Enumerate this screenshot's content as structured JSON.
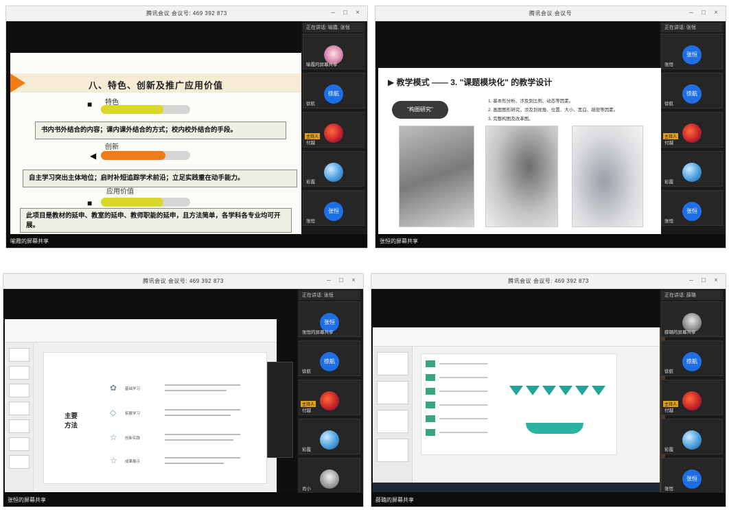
{
  "windows": [
    {
      "title": "腾讯会议 会议号: 469 392 873",
      "share_label": "喻霞的屏幕共享",
      "speaking": "正在讲话: 喻霞, 张恒",
      "slide": {
        "title": "八、特色、创新及推广应用价值",
        "sections": [
          {
            "label": "特色",
            "progress": 0.7,
            "color": "#d8d82a",
            "text": "书内书外结合的内容；课内课外结合的方式；校内校外结合的手段。"
          },
          {
            "label": "创新",
            "progress": 0.72,
            "color": "#ef7a1a",
            "text": "自主学习突出主体地位；启时补短追踪学术前沿；立足实践重在动手能力。"
          },
          {
            "label": "应用价值",
            "progress": 0.7,
            "color": "#d8d82a",
            "text": "此项目是教材的延申、教室的延申、教师职能的延申，且方法简单，各学科各专业均可开展。"
          }
        ]
      },
      "participants": [
        {
          "name": "喻霞的屏幕共享",
          "avatar": "photo"
        },
        {
          "name": "徐航",
          "avatar": "blue",
          "avatar_text": "徐航"
        },
        {
          "name": "付越",
          "avatar": "game",
          "host": "主持人"
        },
        {
          "name": "彩霞",
          "avatar": "earth"
        },
        {
          "name": "张恒",
          "avatar": "blue",
          "avatar_text": "张恒"
        }
      ]
    },
    {
      "title": "腾讯会议 会议号",
      "share_label": "张恒的屏幕共享",
      "speaking": "正在讲话: 张恒",
      "slide": {
        "title": "▶ 教学模式 —— 3. \"课题模块化\" 的教学设计",
        "oval": "\"构图研究\"",
        "list": [
          "1. 基本形分析、涉及到比例、动态等因素。",
          "2. 画面图形研究，涉及到视角、位置、大小、黑白、疏密等因素。",
          "3. 完整构图及改革图。"
        ]
      },
      "participants": [
        {
          "name": "张恒",
          "avatar": "blue",
          "avatar_text": "张恒"
        },
        {
          "name": "徐航",
          "avatar": "blue",
          "avatar_text": "徐航"
        },
        {
          "name": "付越",
          "avatar": "game",
          "host": "主持人"
        },
        {
          "name": "彩霞",
          "avatar": "earth"
        },
        {
          "name": "张恒",
          "avatar": "blue",
          "avatar_text": "张恒"
        }
      ]
    },
    {
      "title": "腾讯会议 会议号: 469 392 873",
      "share_label": "张恒的屏幕共享",
      "speaking": "正在讲话: 张恒",
      "slide": {
        "main": "主要\n方法",
        "rows": [
          "基础学习",
          "拓展学习",
          "创新实践",
          "成果展示"
        ]
      },
      "participants": [
        {
          "name": "张恒的屏幕共享",
          "avatar": "blue",
          "avatar_text": "张恒"
        },
        {
          "name": "徐航",
          "avatar": "blue",
          "avatar_text": "徐航"
        },
        {
          "name": "付越",
          "avatar": "game",
          "host": "主持人"
        },
        {
          "name": "彩霞",
          "avatar": "earth"
        },
        {
          "name": "肖小",
          "avatar": "person"
        }
      ]
    },
    {
      "title": "腾讯会议 会议号: 469 392 873",
      "share_label": "薛璐的屏幕共享",
      "speaking": "正在讲话: 薛璐",
      "participants": [
        {
          "name": "薛璐的屏幕共享",
          "avatar": "face"
        },
        {
          "name": "徐航",
          "avatar": "blue",
          "avatar_text": "徐航"
        },
        {
          "name": "付越",
          "avatar": "game",
          "host": "主持人"
        },
        {
          "name": "彩霞",
          "avatar": "earth"
        },
        {
          "name": "张恒",
          "avatar": "blue",
          "avatar_text": "张恒"
        }
      ]
    }
  ]
}
